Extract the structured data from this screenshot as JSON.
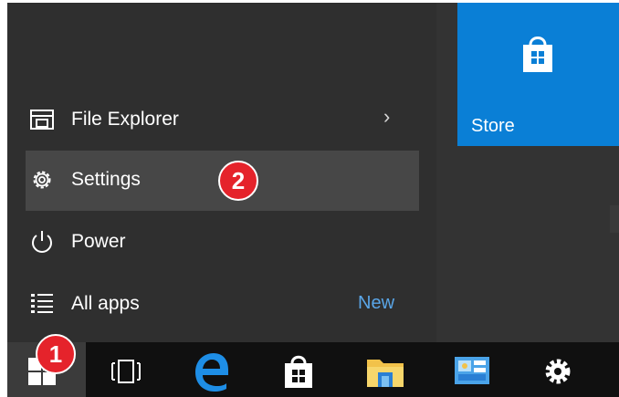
{
  "start_menu": {
    "items": [
      {
        "label": "File Explorer",
        "icon": "file-explorer-icon",
        "has_submenu": true
      },
      {
        "label": "Settings",
        "icon": "gear-icon",
        "highlighted": true
      },
      {
        "label": "Power",
        "icon": "power-icon"
      },
      {
        "label": "All apps",
        "icon": "all-apps-icon",
        "badge": "New"
      }
    ]
  },
  "tiles": {
    "store": {
      "label": "Store",
      "icon": "store-bag-icon",
      "color": "#0a7fd6"
    }
  },
  "callouts": {
    "step1": "1",
    "step2": "2",
    "color": "#e5232b"
  },
  "taskbar": {
    "icons": [
      "windows-start-icon",
      "task-view-icon",
      "edge-icon",
      "store-icon",
      "file-explorer-icon",
      "control-panel-icon",
      "settings-gear-icon"
    ]
  }
}
